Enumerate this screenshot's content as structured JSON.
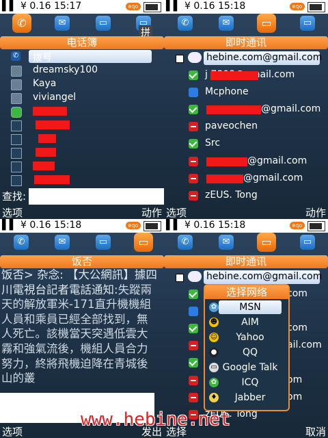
{
  "status": {
    "q1": "¥ 0.16 15:17",
    "q2": "¥ 0.16 15:18",
    "q3": "¥ 0.16 15:18",
    "q4": "¥ 0.16 15:18",
    "eqo": "eqo"
  },
  "q1": {
    "ime": "拼",
    "title": "电话簿",
    "dial": "拨号",
    "contacts": [
      "dreamsky100",
      "Kaya",
      "viviangel"
    ],
    "search_label": "查找:",
    "left": "选项",
    "right": "动作"
  },
  "q2": {
    "title": "即时通讯",
    "account": "hebine.com@gmail.com",
    "rows": [
      {
        "name": "j    7808@gmail.com",
        "status": "on"
      },
      {
        "name": "Mcphone",
        "status": "mc"
      },
      {
        "name": "@gmail.com",
        "status": "on"
      },
      {
        "name": "paveochen",
        "status": "busy"
      },
      {
        "name": "Src",
        "status": "on"
      },
      {
        "name": "@gmail.com",
        "status": "busy"
      },
      {
        "name": "@gmail.com",
        "status": "busy"
      },
      {
        "name": "zEUS. Tong",
        "status": "busy"
      }
    ],
    "left": "选项",
    "right": "动作"
  },
  "q3": {
    "title": "饭否",
    "sms_header": "饭否> 杂念: 【大公網訊】據四川電視台記者電話通知:",
    "sms_body": "失蹤兩天的解放軍米-171直升機機組人員和乘員已經全部找到，無人死亡。該機當天突遇低雲大霧和強氣流後，機組人員合力努力，終將飛機迫降在青城後山的叢",
    "left": "选项",
    "right": "发出"
  },
  "q4": {
    "title": "即时通讯",
    "account": "hebine.com@gmail.com",
    "bg_partial": [
      "com",
      "com",
      "ail.com",
      "om",
      "om"
    ],
    "last": "zEUS. Tong",
    "popup_title": "选择网络",
    "networks": [
      "MSN",
      "AIM",
      "Yahoo",
      "QQ",
      "Google Talk",
      "ICQ",
      "Jabber"
    ],
    "left": "选择",
    "right": "取消"
  },
  "watermark": "www.hebine.net"
}
